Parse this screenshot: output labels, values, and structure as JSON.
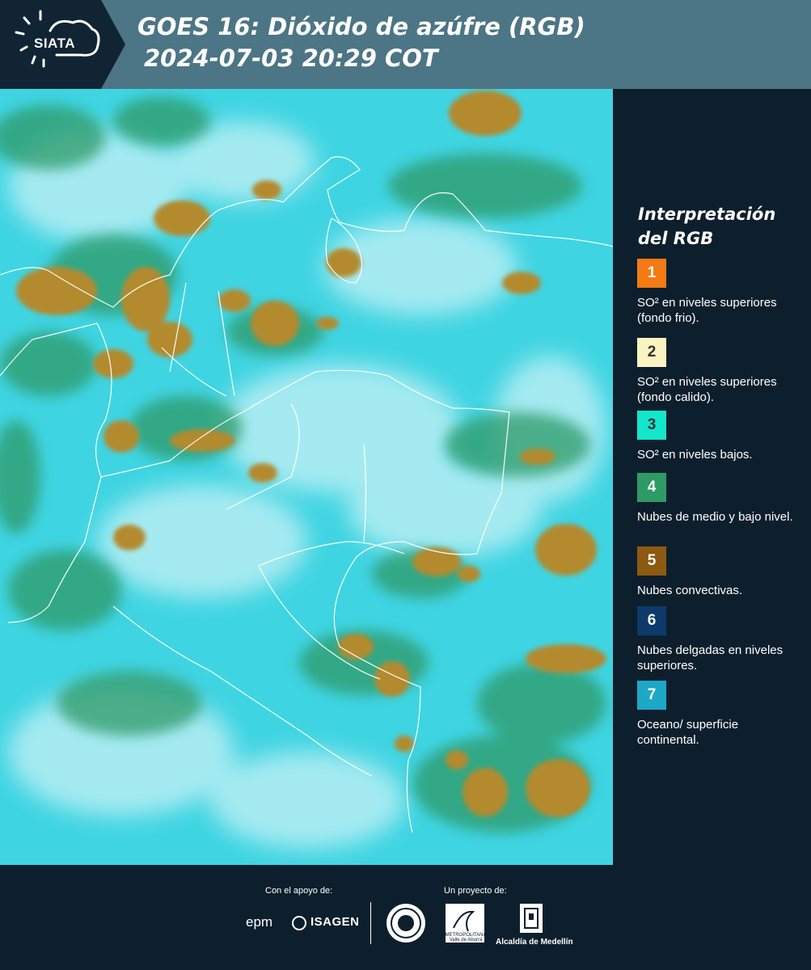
{
  "header": {
    "logo": "SIATA",
    "title_line1": "GOES 16: Dióxido de azúfre (RGB)",
    "title_line2": "2024-07-03 20:29 COT",
    "bg_color": "#4c7585"
  },
  "legend": {
    "title": "Interpretación del RGB",
    "items": [
      {
        "number": "1",
        "color": "#f47a14",
        "text_color": "#ffffff",
        "label": "SO² en niveles superiores (fondo frio)."
      },
      {
        "number": "2",
        "color": "#fbf3c2",
        "text_color": "#333333",
        "label": "SO² en niveles superiores (fondo calido)."
      },
      {
        "number": "3",
        "color": "#14e6cc",
        "text_color": "#333333",
        "label": "SO² en niveles bajos."
      },
      {
        "number": "4",
        "color": "#2e9a66",
        "text_color": "#ffffff",
        "label": "Nubes de medio y bajo nivel."
      },
      {
        "number": "5",
        "color": "#8c5a10",
        "text_color": "#ffffff",
        "label": "Nubes convectivas."
      },
      {
        "number": "6",
        "color": "#0c3a6a",
        "text_color": "#ffffff",
        "label": "Nubes delgadas en niveles superiores."
      },
      {
        "number": "7",
        "color": "#1ea8c8",
        "text_color": "#ffffff",
        "label": "Oceano/ superficie continental."
      }
    ]
  },
  "footer": {
    "support_label": "Con el apoyo de:",
    "project_label": "Un proyecto de:",
    "sponsors": [
      "epm",
      "ISAGEN"
    ],
    "partners": [
      "METROPOLITANA Valle de Aburrá",
      "Alcaldía de Medellín"
    ]
  },
  "icons": [
    "sun-cloud-icon",
    "isagen-mark-icon",
    "medellin-seal-icon",
    "area-metropolitana-icon",
    "alcaldia-building-icon"
  ]
}
